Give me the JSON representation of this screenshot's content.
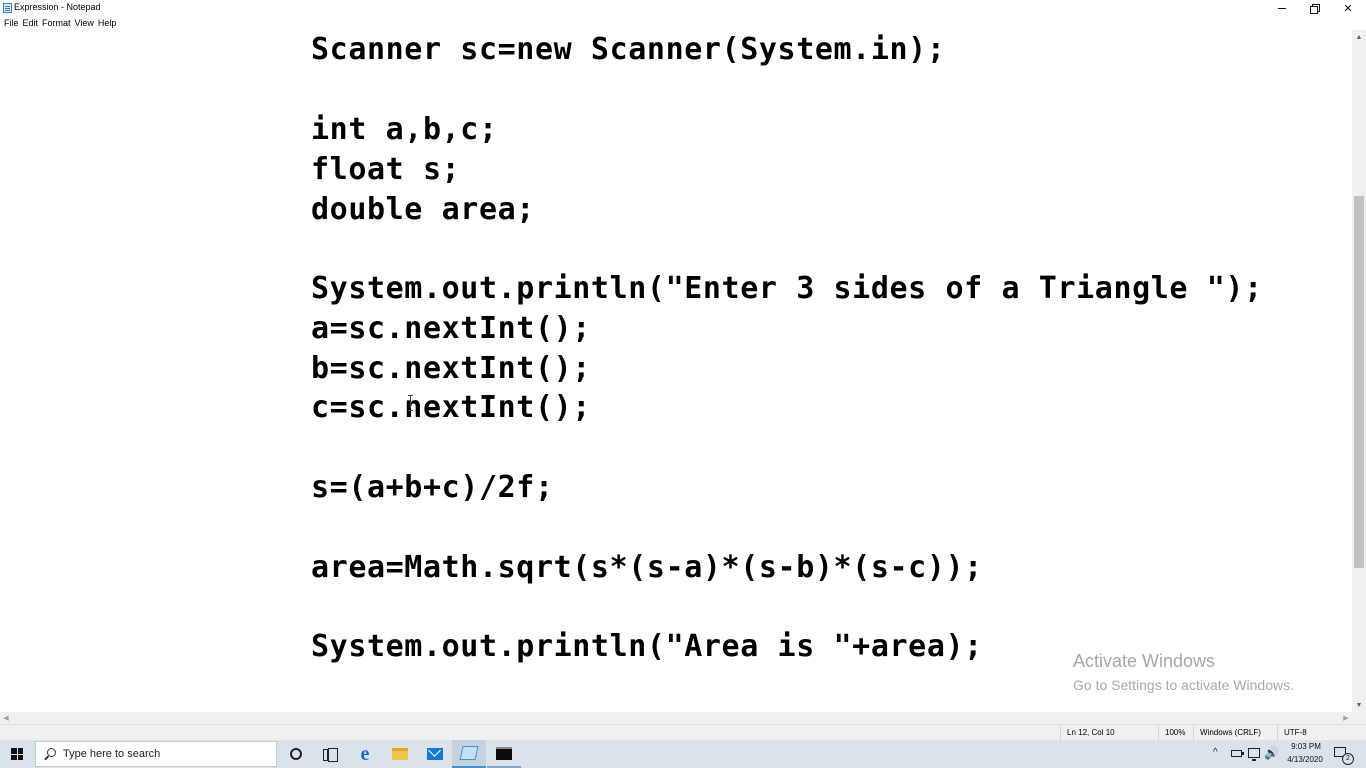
{
  "window": {
    "title": "Expression - Notepad",
    "minimize_label": "—",
    "close_label": "✕"
  },
  "menu": {
    "items": [
      "File",
      "Edit",
      "Format",
      "View",
      "Help"
    ]
  },
  "editor": {
    "lines": [
      "Scanner sc=new Scanner(System.in);",
      "int a,b,c;",
      "float s;",
      "double area;",
      "System.out.println(\"Enter 3 sides of a Triangle \");",
      "a=sc.nextInt();",
      "b=sc.nextInt();",
      "c=sc.nextInt();",
      "s=(a+b+c)/2f;",
      "area=Math.sqrt(s*(s-a)*(s-b)*(s-c));",
      "System.out.println(\"Area is \"+area);"
    ]
  },
  "scrollbars": {
    "up": "▲",
    "down": "▼",
    "left": "◀",
    "right": "▶"
  },
  "statusbar": {
    "position": "Ln 12, Col 10",
    "zoom": "100%",
    "line_endings": "Windows (CRLF)",
    "encoding": "UTF-8"
  },
  "watermark": {
    "title": "Activate Windows",
    "subtitle": "Go to Settings to activate Windows."
  },
  "taskbar": {
    "search_placeholder": "Type here to search",
    "edge_glyph": "e",
    "tray_up_glyph": "^",
    "volume_glyph": "🔊",
    "time": "9:03 PM",
    "date": "4/13/2020",
    "notification_count": "2"
  },
  "colors": {
    "editor_background": "#ffffff",
    "text": "#000000",
    "taskbar": "#dbe3ea",
    "watermark": "#a8a8a8",
    "accent": "#0f6ccf"
  },
  "icons": [
    "notepad-icon",
    "minimize-icon",
    "maximize-icon",
    "close-icon",
    "windows-logo-icon",
    "search-icon",
    "cortana-icon",
    "task-view-icon",
    "edge-icon",
    "file-explorer-icon",
    "mail-icon",
    "notepad-taskbar-icon",
    "command-prompt-icon",
    "battery-icon",
    "network-icon",
    "volume-icon",
    "notification-icon"
  ]
}
